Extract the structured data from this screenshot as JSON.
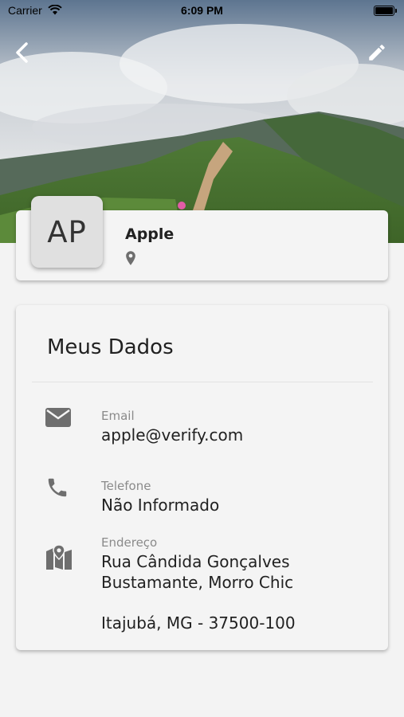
{
  "status_bar": {
    "carrier": "Carrier",
    "time": "6:09 PM"
  },
  "header": {
    "back_icon": "chevron-left-icon",
    "edit_icon": "pencil-icon"
  },
  "profile": {
    "initials": "AP",
    "name": "Apple",
    "location_icon": "map-pin-icon"
  },
  "my_data": {
    "title": "Meus Dados",
    "email": {
      "icon": "envelope-icon",
      "label": "Email",
      "value": "apple@verify.com"
    },
    "phone": {
      "icon": "phone-icon",
      "label": "Telefone",
      "value": "Não Informado"
    },
    "address": {
      "icon": "map-icon",
      "label": "Endereço",
      "line1": "Rua Cândida Gonçalves",
      "line2": "Bustamante, Morro Chic",
      "line3": "Itajubá, MG - 37500-100"
    }
  },
  "colors": {
    "background": "#f3f3f3",
    "card": "#f4f4f4",
    "icon_gray": "#6e6e6e",
    "label_gray": "#8a8a8a"
  }
}
